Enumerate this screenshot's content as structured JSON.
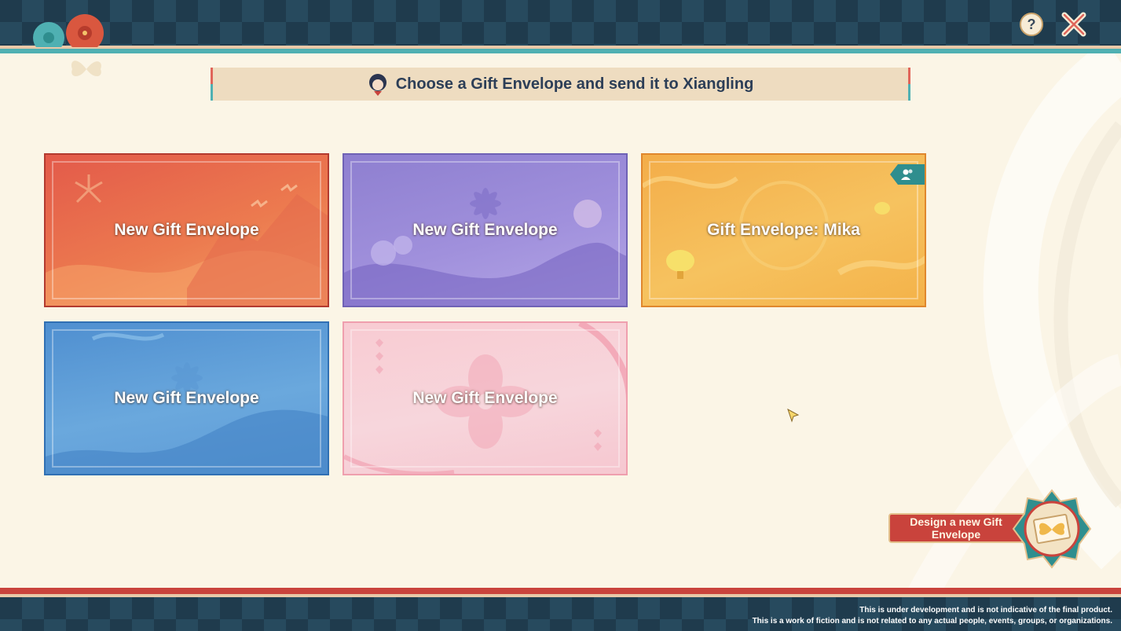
{
  "header": {
    "help_icon": "question-icon",
    "close_icon": "close-icon"
  },
  "banner": {
    "text": "Choose a Gift Envelope and send it to Xiangling"
  },
  "envelopes": [
    {
      "label": "New Gift Envelope",
      "theme": "red",
      "color": "#e35a4a"
    },
    {
      "label": "New Gift Envelope",
      "theme": "purple",
      "color": "#9a8ad8"
    },
    {
      "label": "Gift Envelope: Mika",
      "theme": "gold",
      "color": "#f4b84f",
      "badge_icon": "shared-people-icon"
    },
    {
      "label": "New Gift Envelope",
      "theme": "blue",
      "color": "#5d9ad6"
    },
    {
      "label": "New Gift Envelope",
      "theme": "pink",
      "color": "#f7d0d7"
    }
  ],
  "design_button": {
    "label": "Design a new Gift Envelope"
  },
  "footer": {
    "disclaimer_line1": "This is under development and is not indicative of the final product.",
    "disclaimer_line2": "This is a work of fiction and is not related to any actual people, events, groups, or organizations."
  },
  "colors": {
    "accent_teal": "#4fb0b2",
    "accent_red": "#c9433c",
    "banner_bg": "#eedcc0",
    "page_bg": "#fbf5e6"
  }
}
